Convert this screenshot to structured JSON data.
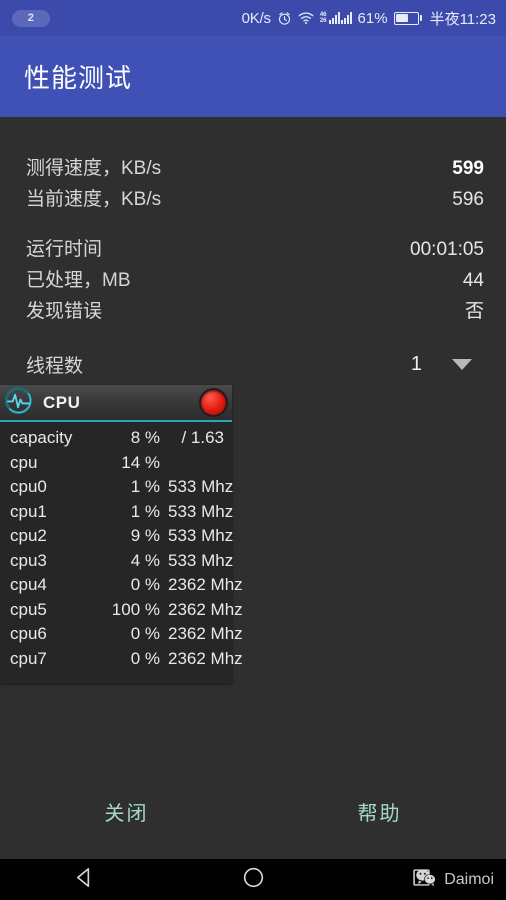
{
  "statusbar": {
    "badge_count": "2",
    "net_speed": "0K/s",
    "alarm_icon": "alarm-clock-icon",
    "wifi_icon": "wifi-icon",
    "signal_gen_top": "46",
    "signal_gen_bottom": "26",
    "signal_icon": "cellular-signal-icon",
    "battery_pct": "61%",
    "battery_icon": "battery-icon",
    "clock": "半夜11:23"
  },
  "appbar": {
    "title": "性能测试"
  },
  "stats": {
    "group1": [
      {
        "label": "测得速度，KB/s",
        "value": "599",
        "bold": true
      },
      {
        "label": "当前速度，KB/s",
        "value": "596",
        "bold": false
      }
    ],
    "group2": [
      {
        "label": "运行时间",
        "value": "00:01:05",
        "bold": false
      },
      {
        "label": "已处理，MB",
        "value": "44",
        "bold": false
      },
      {
        "label": "发现错误",
        "value": "否",
        "bold": false
      }
    ],
    "threads": {
      "label": "线程数",
      "value": "1",
      "caret_icon": "chevron-down-icon"
    }
  },
  "cpu_widget": {
    "icon": "pulse-monitor-icon",
    "title": "CPU",
    "record_button_icon": "record-button-icon",
    "rows": [
      {
        "name": "capacity",
        "pct": "8 %",
        "extra": "/ 1.63"
      },
      {
        "name": "cpu",
        "pct": "14 %",
        "extra": ""
      },
      {
        "name": "cpu0",
        "pct": "1 %",
        "extra": "533 Mhz"
      },
      {
        "name": "cpu1",
        "pct": "1 %",
        "extra": "533 Mhz"
      },
      {
        "name": "cpu2",
        "pct": "9 %",
        "extra": "533 Mhz"
      },
      {
        "name": "cpu3",
        "pct": "4 %",
        "extra": "533 Mhz"
      },
      {
        "name": "cpu4",
        "pct": "0 %",
        "extra": "2362 Mhz"
      },
      {
        "name": "cpu5",
        "pct": "100 %",
        "extra": "2362 Mhz"
      },
      {
        "name": "cpu6",
        "pct": "0 %",
        "extra": "2362 Mhz"
      },
      {
        "name": "cpu7",
        "pct": "0 %",
        "extra": "2362 Mhz"
      }
    ]
  },
  "footer": {
    "close_label": "关闭",
    "help_label": "帮助"
  },
  "navbar": {
    "back_icon": "back-triangle-icon",
    "home_icon": "home-circle-icon",
    "recents_icon": "recents-square-icon",
    "watermark_icon": "wechat-icon",
    "watermark_text": "Daimoi"
  },
  "colors": {
    "appbar_blue": "#3f51b5",
    "statusbar_blue": "#3b4aab",
    "content_bg": "#2f2f2f",
    "widget_bg": "#262626",
    "accent_teal": "#2aa6b8",
    "footer_text": "#a7d8cd",
    "record_red": "#e01b10"
  }
}
